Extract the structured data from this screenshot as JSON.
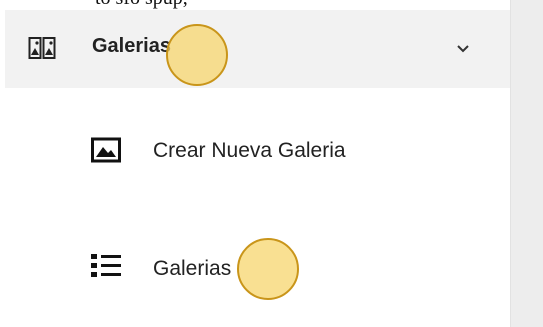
{
  "top_cut_text": "to sfo spup,",
  "sidebar": {
    "group": {
      "label": "Galerias",
      "icon": "gallery-compare-icon",
      "chevron": "chevron-down-icon",
      "expanded": true
    },
    "items": [
      {
        "label": "Crear Nueva Galeria",
        "icon": "image-icon"
      },
      {
        "label": "Galerias",
        "icon": "list-icon"
      }
    ]
  },
  "colors": {
    "header_bg": "#f2f2f2",
    "right_panel_bg": "#ededed",
    "click_marker_fill": "#f7d56e",
    "click_marker_border": "#c9951a",
    "text": "#222222"
  }
}
